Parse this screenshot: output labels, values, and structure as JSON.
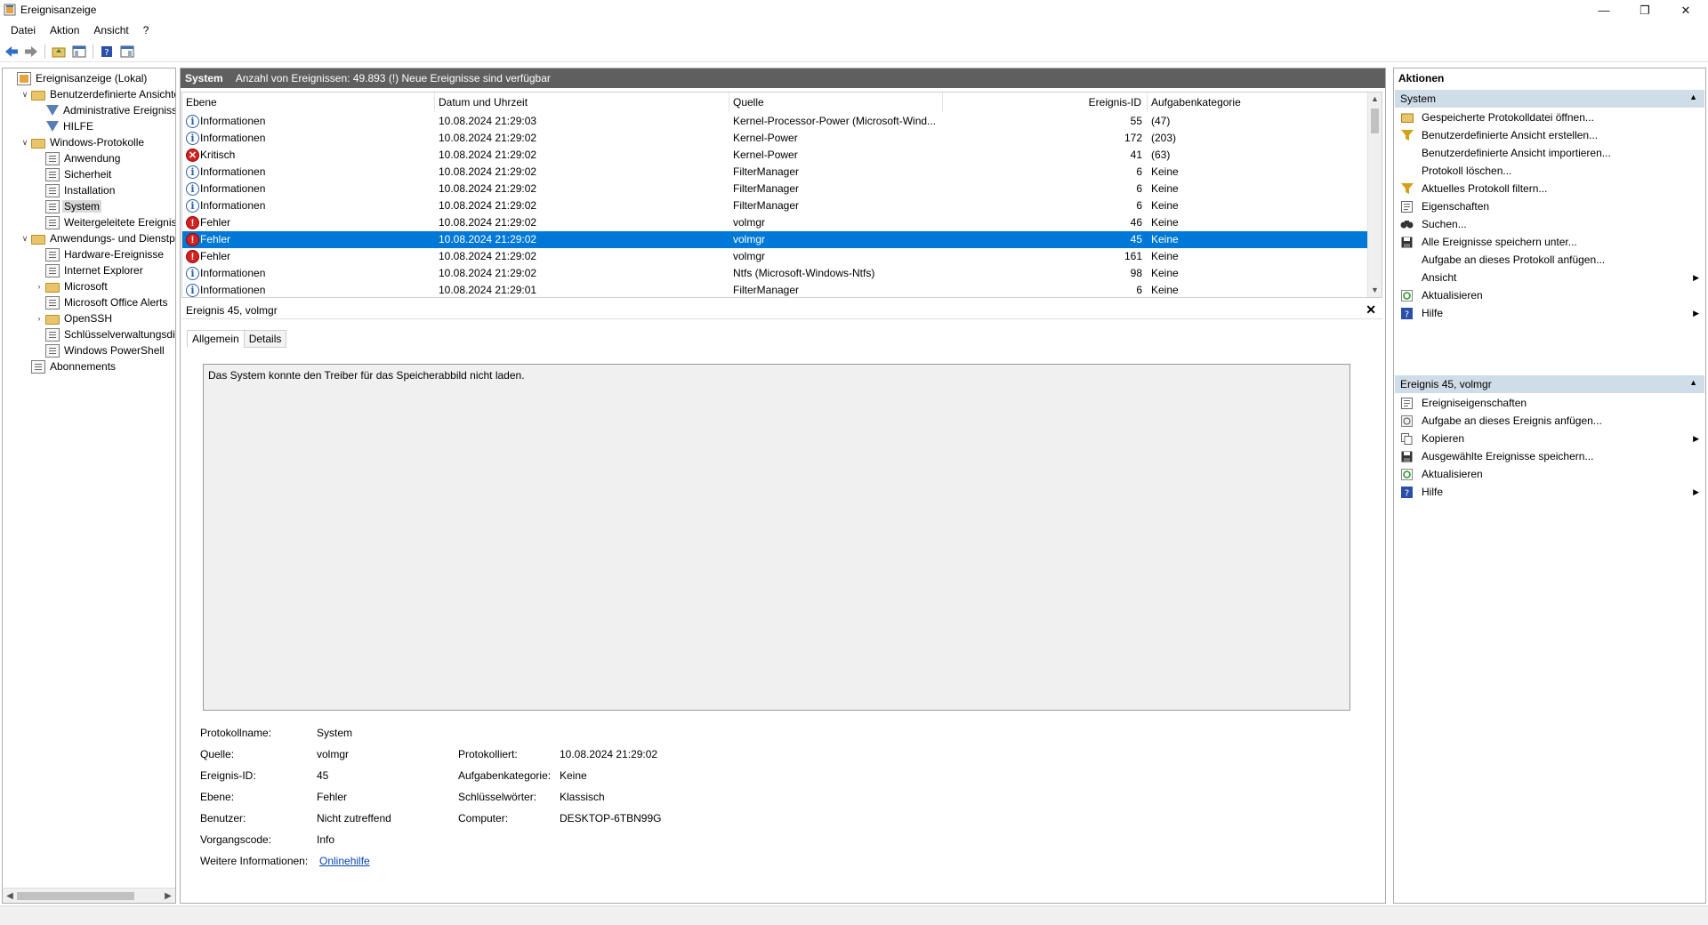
{
  "window": {
    "title": "Ereignisanzeige"
  },
  "menu": [
    "Datei",
    "Aktion",
    "Ansicht",
    "?"
  ],
  "tree": [
    {
      "label": "Ereignisanzeige (Lokal)",
      "depth": 0,
      "icon": "root",
      "exp": ""
    },
    {
      "label": "Benutzerdefinierte Ansichten",
      "depth": 1,
      "icon": "folder",
      "exp": "v"
    },
    {
      "label": "Administrative Ereignisse",
      "depth": 2,
      "icon": "filter",
      "exp": ""
    },
    {
      "label": "HILFE",
      "depth": 2,
      "icon": "filter",
      "exp": ""
    },
    {
      "label": "Windows-Protokolle",
      "depth": 1,
      "icon": "folder",
      "exp": "v"
    },
    {
      "label": "Anwendung",
      "depth": 2,
      "icon": "log",
      "exp": ""
    },
    {
      "label": "Sicherheit",
      "depth": 2,
      "icon": "log",
      "exp": ""
    },
    {
      "label": "Installation",
      "depth": 2,
      "icon": "log",
      "exp": ""
    },
    {
      "label": "System",
      "depth": 2,
      "icon": "log",
      "exp": "",
      "selected": true
    },
    {
      "label": "Weitergeleitete Ereignisse",
      "depth": 2,
      "icon": "log",
      "exp": ""
    },
    {
      "label": "Anwendungs- und Dienstprotokolle",
      "depth": 1,
      "icon": "folder",
      "exp": "v"
    },
    {
      "label": "Hardware-Ereignisse",
      "depth": 2,
      "icon": "log",
      "exp": ""
    },
    {
      "label": "Internet Explorer",
      "depth": 2,
      "icon": "log",
      "exp": ""
    },
    {
      "label": "Microsoft",
      "depth": 2,
      "icon": "folder",
      "exp": ">"
    },
    {
      "label": "Microsoft Office Alerts",
      "depth": 2,
      "icon": "log",
      "exp": ""
    },
    {
      "label": "OpenSSH",
      "depth": 2,
      "icon": "folder",
      "exp": ">"
    },
    {
      "label": "Schlüsselverwaltungsdienst",
      "depth": 2,
      "icon": "log",
      "exp": ""
    },
    {
      "label": "Windows PowerShell",
      "depth": 2,
      "icon": "log",
      "exp": ""
    },
    {
      "label": "Abonnements",
      "depth": 1,
      "icon": "log",
      "exp": ""
    }
  ],
  "center": {
    "header_title": "System",
    "header_info": "Anzahl von Ereignissen: 49.893 (!) Neue Ereignisse sind verfügbar"
  },
  "columns": [
    "Ebene",
    "Datum und Uhrzeit",
    "Quelle",
    "Ereignis-ID",
    "Aufgabenkategorie"
  ],
  "events": [
    {
      "level": "Informationen",
      "type": "info",
      "date": "10.08.2024 21:29:03",
      "source": "Kernel-Processor-Power (Microsoft-Wind...",
      "id": "55",
      "task": "(47)"
    },
    {
      "level": "Informationen",
      "type": "info",
      "date": "10.08.2024 21:29:02",
      "source": "Kernel-Power",
      "id": "172",
      "task": "(203)"
    },
    {
      "level": "Kritisch",
      "type": "crit",
      "date": "10.08.2024 21:29:02",
      "source": "Kernel-Power",
      "id": "41",
      "task": "(63)"
    },
    {
      "level": "Informationen",
      "type": "info",
      "date": "10.08.2024 21:29:02",
      "source": "FilterManager",
      "id": "6",
      "task": "Keine"
    },
    {
      "level": "Informationen",
      "type": "info",
      "date": "10.08.2024 21:29:02",
      "source": "FilterManager",
      "id": "6",
      "task": "Keine"
    },
    {
      "level": "Informationen",
      "type": "info",
      "date": "10.08.2024 21:29:02",
      "source": "FilterManager",
      "id": "6",
      "task": "Keine"
    },
    {
      "level": "Fehler",
      "type": "err",
      "date": "10.08.2024 21:29:02",
      "source": "volmgr",
      "id": "46",
      "task": "Keine"
    },
    {
      "level": "Fehler",
      "type": "err",
      "date": "10.08.2024 21:29:02",
      "source": "volmgr",
      "id": "45",
      "task": "Keine",
      "selected": true
    },
    {
      "level": "Fehler",
      "type": "err",
      "date": "10.08.2024 21:29:02",
      "source": "volmgr",
      "id": "161",
      "task": "Keine"
    },
    {
      "level": "Informationen",
      "type": "info",
      "date": "10.08.2024 21:29:02",
      "source": "Ntfs (Microsoft-Windows-Ntfs)",
      "id": "98",
      "task": "Keine"
    },
    {
      "level": "Informationen",
      "type": "info",
      "date": "10.08.2024 21:29:01",
      "source": "FilterManager",
      "id": "6",
      "task": "Keine"
    }
  ],
  "detail": {
    "title": "Ereignis 45, volmgr",
    "tabs": [
      "Allgemein",
      "Details"
    ],
    "description": "Das System konnte den Treiber für das Speicherabbild nicht laden.",
    "fields": {
      "protokollname_label": "Protokollname:",
      "protokollname": "System",
      "quelle_label": "Quelle:",
      "quelle": "volmgr",
      "protokolliert_label": "Protokolliert:",
      "protokolliert": "10.08.2024 21:29:02",
      "id_label": "Ereignis-ID:",
      "id": "45",
      "aufgabe_label": "Aufgabenkategorie:",
      "aufgabe": "Keine",
      "ebene_label": "Ebene:",
      "ebene": "Fehler",
      "schluessel_label": "Schlüsselwörter:",
      "schluessel": "Klassisch",
      "benutzer_label": "Benutzer:",
      "benutzer": "Nicht zutreffend",
      "computer_label": "Computer:",
      "computer": "DESKTOP-6TBN99G",
      "vorgang_label": "Vorgangscode:",
      "vorgang": "Info",
      "weitere_label": "Weitere Informationen:",
      "weitere_link": "Onlinehilfe"
    }
  },
  "actions": {
    "title": "Aktionen",
    "section1": "System",
    "items1": [
      {
        "label": "Gespeicherte Protokolldatei öffnen...",
        "icon": "open-folder-icon",
        "sub": false
      },
      {
        "label": "Benutzerdefinierte Ansicht erstellen...",
        "icon": "filter-icon",
        "sub": false
      },
      {
        "label": "Benutzerdefinierte Ansicht importieren...",
        "icon": "",
        "sub": false
      },
      {
        "label": "Protokoll löschen...",
        "icon": "",
        "sub": false
      },
      {
        "label": "Aktuelles Protokoll filtern...",
        "icon": "filter-icon",
        "sub": false
      },
      {
        "label": "Eigenschaften",
        "icon": "properties-icon",
        "sub": false
      },
      {
        "label": "Suchen...",
        "icon": "binoculars-icon",
        "sub": false
      },
      {
        "label": "Alle Ereignisse speichern unter...",
        "icon": "save-icon",
        "sub": false
      },
      {
        "label": "Aufgabe an dieses Protokoll anfügen...",
        "icon": "",
        "sub": false
      },
      {
        "label": "Ansicht",
        "icon": "",
        "sub": true
      },
      {
        "label": "Aktualisieren",
        "icon": "refresh-icon",
        "sub": false
      },
      {
        "label": "Hilfe",
        "icon": "help-icon",
        "sub": true
      }
    ],
    "section2": "Ereignis 45, volmgr",
    "items2": [
      {
        "label": "Ereigniseigenschaften",
        "icon": "properties-icon",
        "sub": false
      },
      {
        "label": "Aufgabe an dieses Ereignis anfügen...",
        "icon": "task-icon",
        "sub": false
      },
      {
        "label": "Kopieren",
        "icon": "copy-icon",
        "sub": true
      },
      {
        "label": "Ausgewählte Ereignisse speichern...",
        "icon": "save-icon",
        "sub": false
      },
      {
        "label": "Aktualisieren",
        "icon": "refresh-icon",
        "sub": false
      },
      {
        "label": "Hilfe",
        "icon": "help-icon",
        "sub": true
      }
    ]
  }
}
